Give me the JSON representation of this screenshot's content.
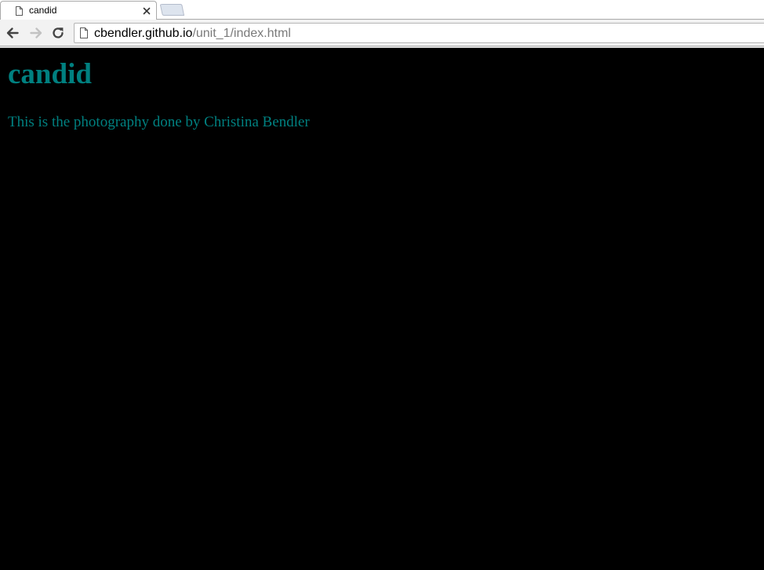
{
  "browser": {
    "tab": {
      "title": "candid",
      "icon": "page-icon",
      "close_icon": "close-icon"
    },
    "new_tab_icon": "new-tab-icon",
    "nav": {
      "back_icon": "back-arrow-icon",
      "forward_icon": "forward-arrow-icon",
      "reload_icon": "reload-icon"
    },
    "address_bar": {
      "icon": "page-icon",
      "host": "cbendler.github.io",
      "path": "/unit_1/index.html"
    }
  },
  "page": {
    "heading": "candid",
    "paragraph": "This is the photography done by Christina Bendler",
    "background_color": "#000000",
    "text_color": "#008080"
  }
}
